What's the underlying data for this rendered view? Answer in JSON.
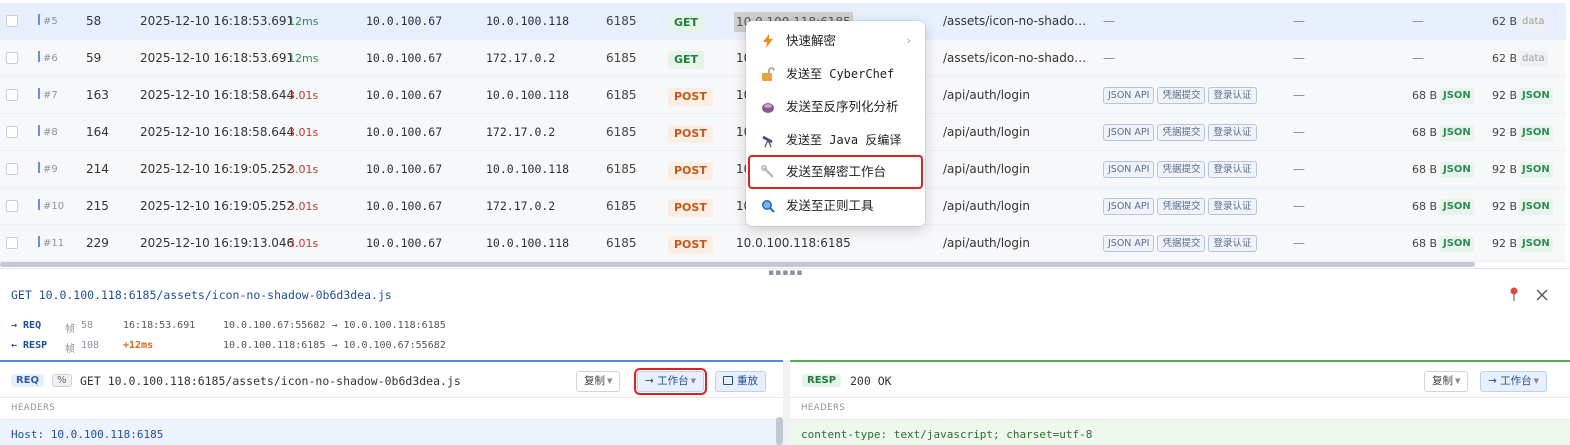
{
  "rows": [
    {
      "id": "#5",
      "frame": "58",
      "time": "2025-12-10 16:18:53.691",
      "duration": "12ms",
      "src": "10.0.100.67",
      "dst": "10.0.100.118",
      "port": "6185",
      "method": "GET",
      "host": "10.0.100.118:6185",
      "path": "/assets/icon-no-shadow-0...",
      "tags": [],
      "req_size": "",
      "req_type": "",
      "resp_size": "62 B",
      "resp_type": "data"
    },
    {
      "id": "#6",
      "frame": "59",
      "time": "2025-12-10 16:18:53.691",
      "duration": "12ms",
      "src": "10.0.100.67",
      "dst": "172.17.0.2",
      "port": "6185",
      "method": "GET",
      "host": "10",
      "path": "/assets/icon-no-shadow-0...",
      "tags": [],
      "req_size": "",
      "req_type": "",
      "resp_size": "62 B",
      "resp_type": "data"
    },
    {
      "id": "#7",
      "frame": "163",
      "time": "2025-12-10 16:18:58.644",
      "duration": "3.01s",
      "src": "10.0.100.67",
      "dst": "10.0.100.118",
      "port": "6185",
      "method": "POST",
      "host": "10",
      "path": "/api/auth/login",
      "tags": [
        "JSON API",
        "凭据提交",
        "登录认证"
      ],
      "req_size": "68 B",
      "req_type": "JSON",
      "resp_size": "92 B",
      "resp_type": "JSON"
    },
    {
      "id": "#8",
      "frame": "164",
      "time": "2025-12-10 16:18:58.644",
      "duration": "3.01s",
      "src": "10.0.100.67",
      "dst": "172.17.0.2",
      "port": "6185",
      "method": "POST",
      "host": "10",
      "path": "/api/auth/login",
      "tags": [
        "JSON API",
        "凭据提交",
        "登录认证"
      ],
      "req_size": "68 B",
      "req_type": "JSON",
      "resp_size": "92 B",
      "resp_type": "JSON"
    },
    {
      "id": "#9",
      "frame": "214",
      "time": "2025-12-10 16:19:05.252",
      "duration": "3.01s",
      "src": "10.0.100.67",
      "dst": "10.0.100.118",
      "port": "6185",
      "method": "POST",
      "host": "10",
      "path": "/api/auth/login",
      "tags": [
        "JSON API",
        "凭据提交",
        "登录认证"
      ],
      "req_size": "68 B",
      "req_type": "JSON",
      "resp_size": "92 B",
      "resp_type": "JSON"
    },
    {
      "id": "#10",
      "frame": "215",
      "time": "2025-12-10 16:19:05.252",
      "duration": "3.01s",
      "src": "10.0.100.67",
      "dst": "172.17.0.2",
      "port": "6185",
      "method": "POST",
      "host": "10",
      "path": "/api/auth/login",
      "tags": [
        "JSON API",
        "凭据提交",
        "登录认证"
      ],
      "req_size": "68 B",
      "req_type": "JSON",
      "resp_size": "92 B",
      "resp_type": "JSON"
    },
    {
      "id": "#11",
      "frame": "229",
      "time": "2025-12-10 16:19:13.046",
      "duration": "3.01s",
      "src": "10.0.100.67",
      "dst": "10.0.100.118",
      "port": "6185",
      "method": "POST",
      "host": "10.0.100.118:6185",
      "path": "/api/auth/login",
      "tags": [
        "JSON API",
        "凭据提交",
        "登录认证"
      ],
      "req_size": "68 B",
      "req_type": "JSON",
      "resp_size": "92 B",
      "resp_type": "JSON"
    }
  ],
  "empty_cell": "—",
  "context_menu": {
    "items": [
      {
        "label": "快速解密",
        "icon": "bolt-icon",
        "submenu": "›"
      },
      {
        "label": "发送至 CyberChef",
        "icon": "unlock-icon"
      },
      {
        "label": "发送至反序列化分析",
        "icon": "bowl-icon"
      },
      {
        "label": "发送至 Java 反编译",
        "icon": "telescope-icon"
      },
      {
        "label": "发送至解密工作台",
        "icon": "wrench-icon",
        "highlighted": true
      },
      {
        "label": "发送至正则工具",
        "icon": "magnifier-icon"
      }
    ]
  },
  "detail": {
    "title": "GET 10.0.100.118:6185/assets/icon-no-shadow-0b6d3dea.js",
    "req_flow": {
      "dir": "→ REQ",
      "frame_label": "帧",
      "frame": "58",
      "time": "16:18:53.691",
      "addr": "10.0.100.67:55682 → 10.0.100.118:6185"
    },
    "resp_flow": {
      "dir": "← RESP",
      "frame_label": "帧",
      "frame": "108",
      "time": "+12ms",
      "addr": "10.0.100.118:6185 → 10.0.100.67:55682"
    }
  },
  "req_pane": {
    "badge": "REQ",
    "encode_badge": "%",
    "url": "GET 10.0.100.118:6185/assets/icon-no-shadow-0b6d3dea.js",
    "copy_label": "复制",
    "workbench_label": "→ 工作台",
    "replay_label": "重放",
    "section": "HEADERS",
    "header_line": "Host: 10.0.100.118:6185"
  },
  "resp_pane": {
    "badge": "RESP",
    "status": "200 OK",
    "copy_label": "复制",
    "workbench_label": "→ 工作台",
    "section": "HEADERS",
    "header_line": "content-type: text/javascript; charset=utf-8"
  },
  "colors": {
    "accent": "#4a8fd9",
    "success": "#4caf50",
    "highlight": "#e02020",
    "get": "#257a3e",
    "post": "#c4581c"
  }
}
